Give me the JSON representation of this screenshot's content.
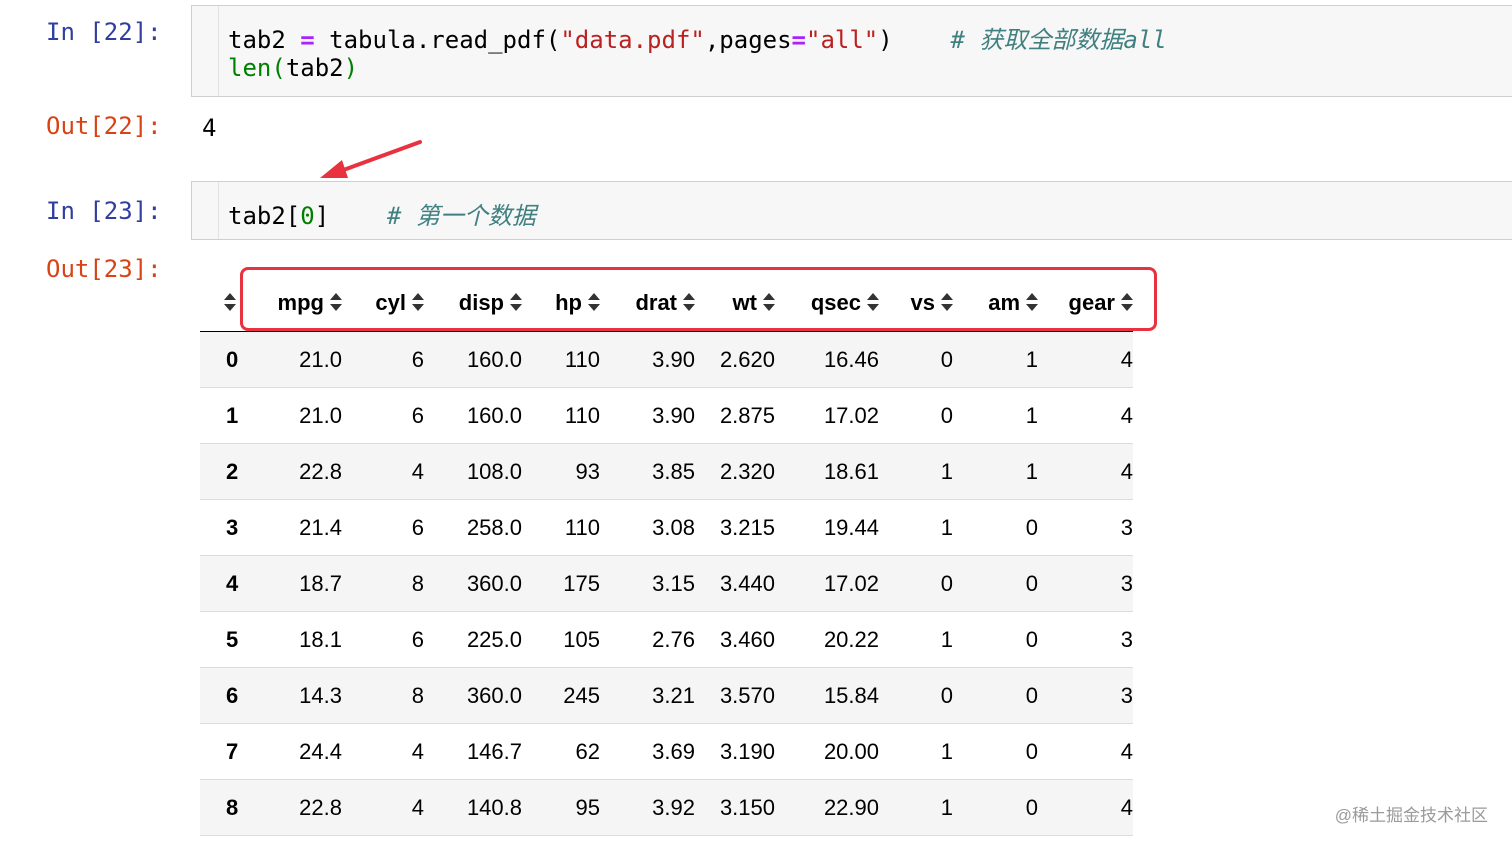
{
  "cells": [
    {
      "in_prompt": "In [22]:",
      "code_line1": {
        "var": "tab2",
        "eq": "=",
        "call": "tabula.read_pdf(",
        "arg1": "\"data.pdf\"",
        "comma": ",pages",
        "eq2": "=",
        "arg2": "\"all\"",
        "close": ")",
        "comment": "# 获取全部数据all"
      },
      "code_line2": {
        "func": "len",
        "open": "(",
        "arg": "tab2",
        "close": ")"
      },
      "out_prompt": "Out[22]:",
      "output": "4"
    },
    {
      "in_prompt": "In [23]:",
      "code_line1": {
        "prefix": "tab2[",
        "index": "0",
        "suffix": "]",
        "comment": "# 第一个数据"
      },
      "out_prompt": "Out[23]:"
    }
  ],
  "dataframe": {
    "columns": [
      "mpg",
      "cyl",
      "disp",
      "hp",
      "drat",
      "wt",
      "qsec",
      "vs",
      "am",
      "gear"
    ],
    "rows": [
      [
        "0",
        "21.0",
        "6",
        "160.0",
        "110",
        "3.90",
        "2.620",
        "16.46",
        "0",
        "1",
        "4"
      ],
      [
        "1",
        "21.0",
        "6",
        "160.0",
        "110",
        "3.90",
        "2.875",
        "17.02",
        "0",
        "1",
        "4"
      ],
      [
        "2",
        "22.8",
        "4",
        "108.0",
        "93",
        "3.85",
        "2.320",
        "18.61",
        "1",
        "1",
        "4"
      ],
      [
        "3",
        "21.4",
        "6",
        "258.0",
        "110",
        "3.08",
        "3.215",
        "19.44",
        "1",
        "0",
        "3"
      ],
      [
        "4",
        "18.7",
        "8",
        "360.0",
        "175",
        "3.15",
        "3.440",
        "17.02",
        "0",
        "0",
        "3"
      ],
      [
        "5",
        "18.1",
        "6",
        "225.0",
        "105",
        "2.76",
        "3.460",
        "20.22",
        "1",
        "0",
        "3"
      ],
      [
        "6",
        "14.3",
        "8",
        "360.0",
        "245",
        "3.21",
        "3.570",
        "15.84",
        "0",
        "0",
        "3"
      ],
      [
        "7",
        "24.4",
        "4",
        "146.7",
        "62",
        "3.69",
        "3.190",
        "20.00",
        "1",
        "0",
        "4"
      ],
      [
        "8",
        "22.8",
        "4",
        "140.8",
        "95",
        "3.92",
        "3.150",
        "22.90",
        "1",
        "0",
        "4"
      ]
    ]
  },
  "annotations": {
    "highlight_color": "#e8323f",
    "arrow_color": "#e8323f"
  },
  "icons": {
    "sort": "sort-arrows-icon"
  },
  "watermark": "@稀土掘金技术社区"
}
